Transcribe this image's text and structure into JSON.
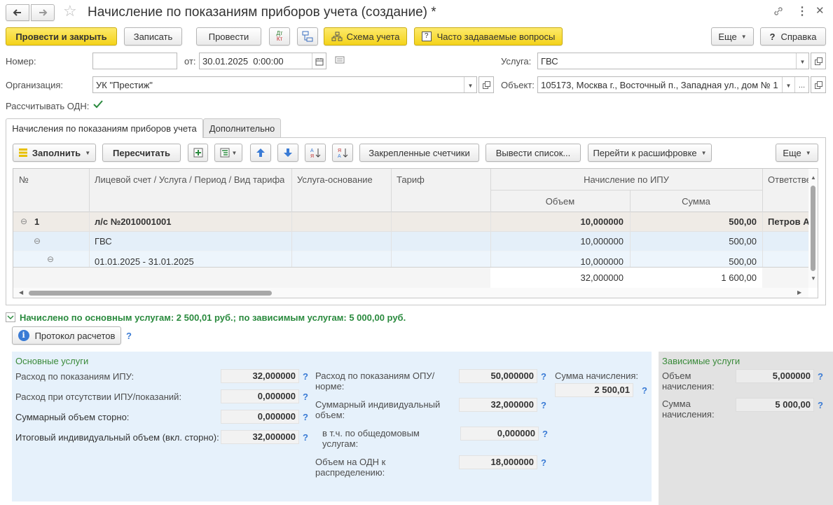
{
  "window": {
    "title": "Начисление по показаниям приборов учета (создание) *"
  },
  "toolbar": {
    "post_close": "Провести и закрыть",
    "save": "Записать",
    "post": "Провести",
    "dt_kt": "Дт/Кт",
    "scheme": "Схема учета",
    "faq": "Часто задаваемые вопросы",
    "more": "Еще",
    "help": "Справка",
    "help_q": "?"
  },
  "header": {
    "number_label": "Номер:",
    "number_value": "",
    "from_label": "от:",
    "date_value": "30.01.2025  0:00:00",
    "org_label": "Организация:",
    "org_value": "УК \"Престиж\"",
    "odn_label": "Рассчитывать ОДН:",
    "service_label": "Услуга:",
    "service_value": "ГВС",
    "object_label": "Объект:",
    "object_value": "105173, Москва г., Восточный п., Западная ул., дом № 1"
  },
  "tabs": [
    {
      "label": "Начисления по показаниям приборов учета",
      "active": true
    },
    {
      "label": "Дополнительно",
      "active": false
    }
  ],
  "grid_toolbar": {
    "fill": "Заполнить",
    "recalc": "Пересчитать",
    "fixed_meters": "Закрепленные счетчики",
    "output_list": "Вывести список...",
    "goto_decode": "Перейти к расшифровке",
    "more": "Еще"
  },
  "grid": {
    "headers": {
      "num": "№",
      "account": "Лицевой счет / Услуга / Период / Вид тарифа",
      "base_service": "Услуга-основание",
      "tariff": "Тариф",
      "ipu_group": "Начисление по ИПУ",
      "volume": "Объем",
      "sum": "Сумма",
      "responsible": "Ответстве"
    },
    "rows": [
      {
        "num": "1",
        "account": "л/с №2010001001",
        "volume": "10,000000",
        "sum": "500,00",
        "responsible": "Петров А"
      },
      {
        "num": "",
        "account": "ГВС",
        "volume": "10,000000",
        "sum": "500,00",
        "responsible": ""
      },
      {
        "num": "",
        "account": "01.01.2025 - 31.01.2025",
        "volume": "10,000000",
        "sum": "500,00",
        "responsible": ""
      }
    ],
    "totals": {
      "volume": "32,000000",
      "sum": "1 600,00"
    }
  },
  "summary": {
    "text": "Начислено по основным услугам: 2 500,01 руб.; по зависимым услугам: 5 000,00 руб.",
    "protocol_button": "Протокол расчетов"
  },
  "main_services": {
    "title": "Основные услуги",
    "ipu_label": "Расход по показаниям ИПУ:",
    "ipu_value": "32,000000",
    "no_ipu_label": "Расход при отсутствии ИПУ/показаний:",
    "no_ipu_value": "0,000000",
    "storno_label": "Суммарный объем сторно:",
    "storno_value": "0,000000",
    "total_label": "Итоговый индивидуальный объем (вкл. сторно):",
    "total_value": "32,000000",
    "opu_label": "Расход по показаниям ОПУ/норме:",
    "opu_value": "50,000000",
    "sum_ind_label": "Суммарный индивидуальный объем:",
    "sum_ind_value": "32,000000",
    "incl_label": "в т.ч. по общедомовым услугам:",
    "incl_value": "0,000000",
    "odn_label": "Объем на ОДН к распределению:",
    "odn_value": "18,000000",
    "accrual_label": "Сумма начисления:",
    "accrual_value": "2 500,01"
  },
  "dependent_services": {
    "title": "Зависимые услуги",
    "volume_label": "Объем начисления:",
    "volume_value": "5,000000",
    "sum_label": "Сумма начисления:",
    "sum_value": "5 000,00"
  },
  "colors": {
    "accent_yellow": "#f4d31a",
    "summary_green": "#2a8a3e",
    "section_title_green": "#3a8a3a",
    "main_bg": "#e6f1fb",
    "dep_bg": "#e2e2e2"
  }
}
